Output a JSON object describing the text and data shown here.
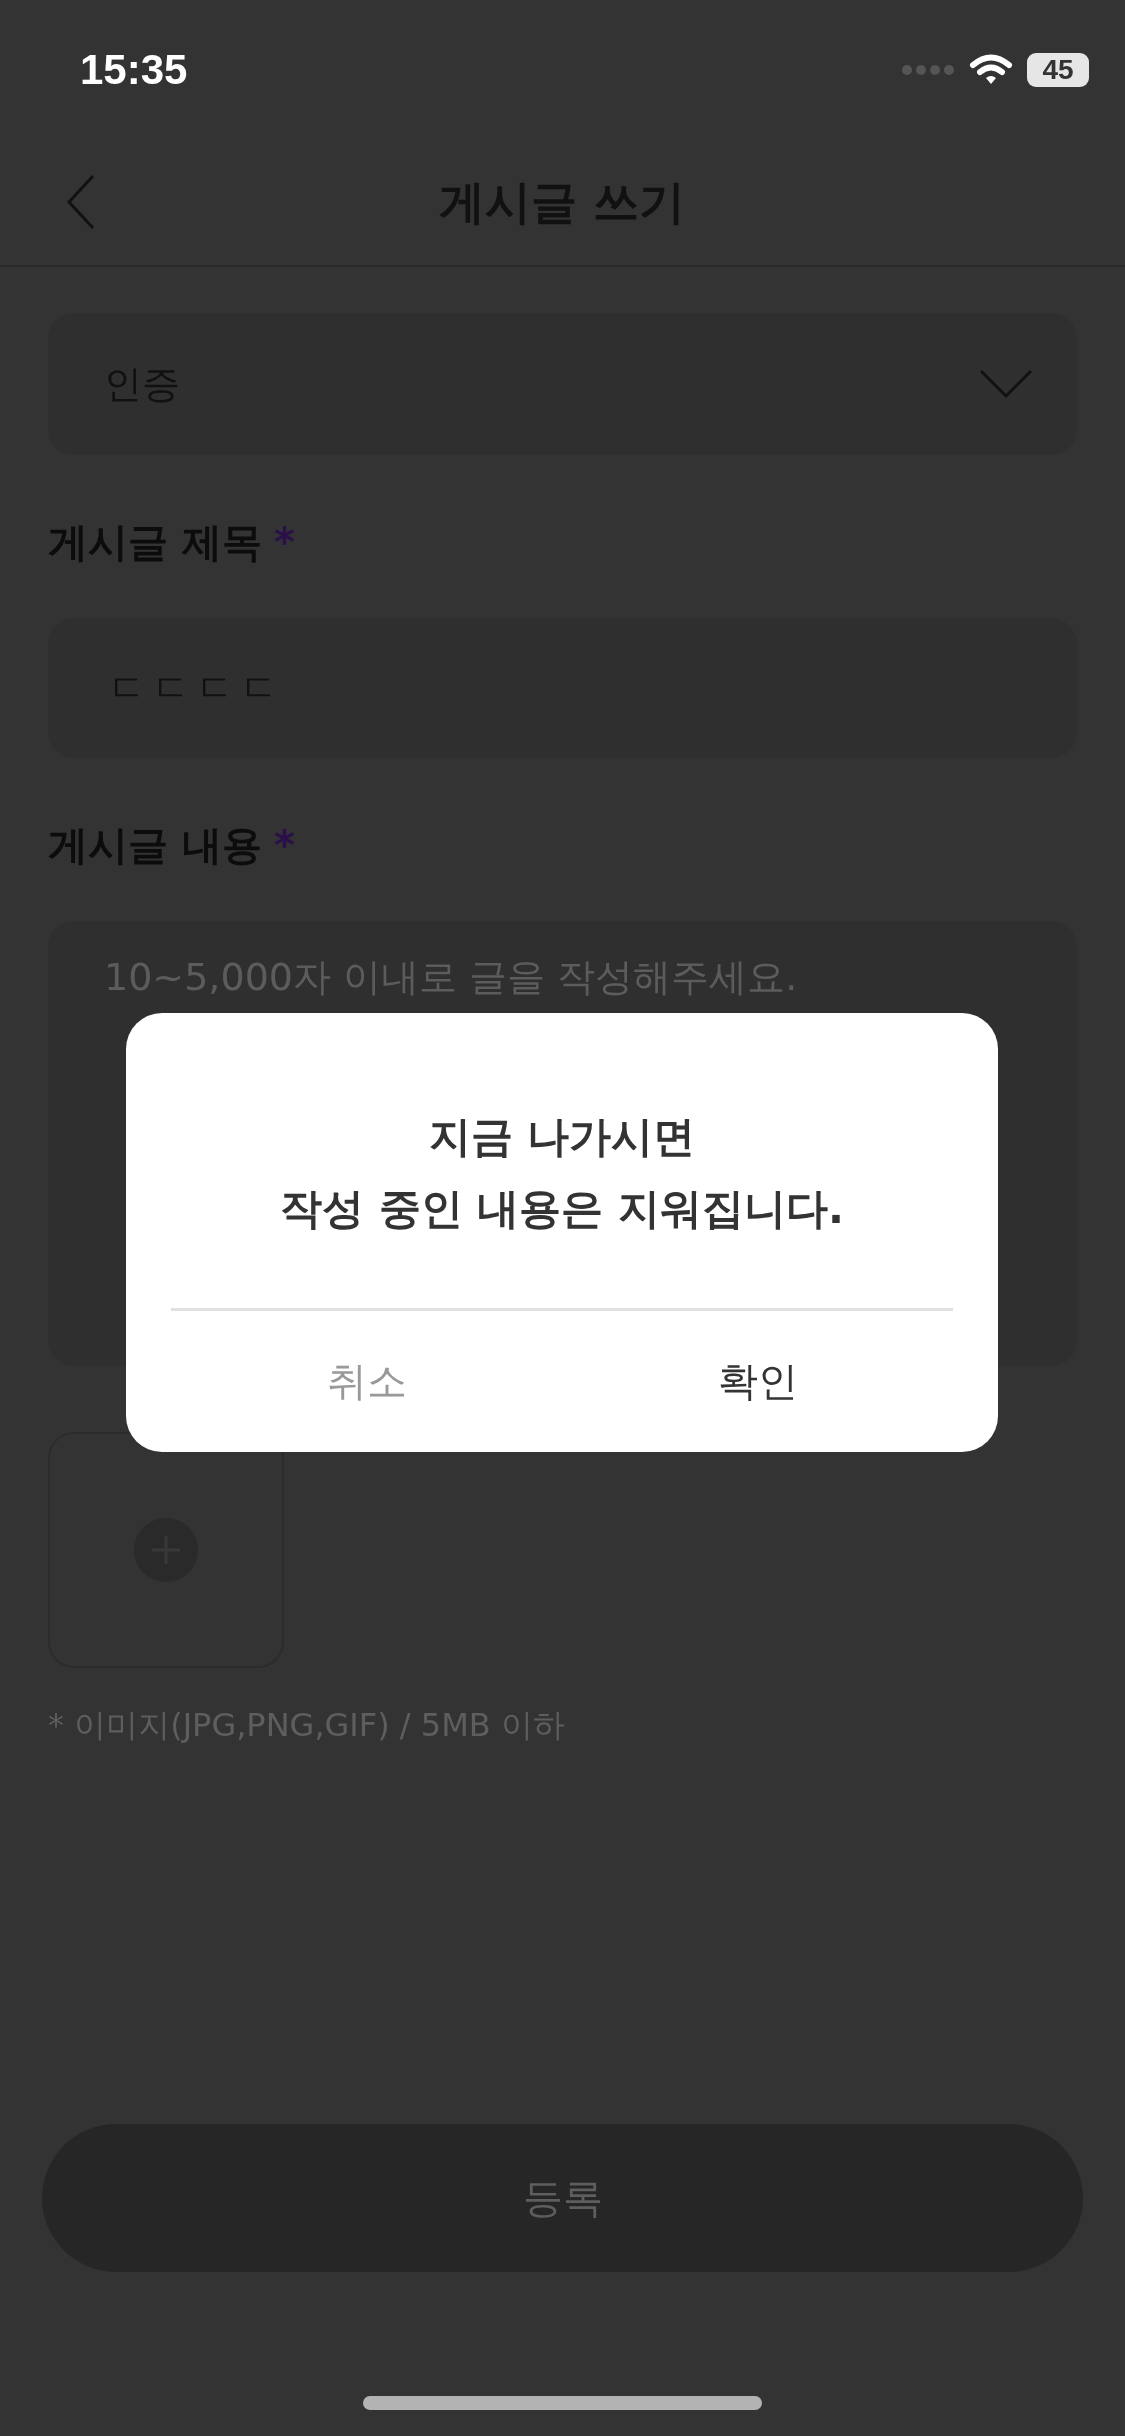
{
  "status_bar": {
    "time": "15:35",
    "battery": "45"
  },
  "header": {
    "title": "게시글 쓰기"
  },
  "category_select": {
    "value": "인증"
  },
  "fields": [
    {
      "label": "게시글 제목",
      "required_mark": "*",
      "kind": "input",
      "value": "ㄷㄷㄷㄷ"
    },
    {
      "label": "게시글 내용",
      "required_mark": "*",
      "kind": "textarea",
      "placeholder": "10~5,000자 이내로 글을 작성해주세요."
    }
  ],
  "image_note": "* 이미지(JPG,PNG,GIF) / 5MB 이하",
  "submit_button": {
    "label": "등록",
    "disabled": true
  },
  "dialog": {
    "message_lines": [
      "지금 나가시면",
      "작성 중인 내용은 지워집니다."
    ],
    "buttons": [
      {
        "label": "취소",
        "kind": "cancel"
      },
      {
        "label": "확인",
        "kind": "confirm"
      }
    ]
  }
}
